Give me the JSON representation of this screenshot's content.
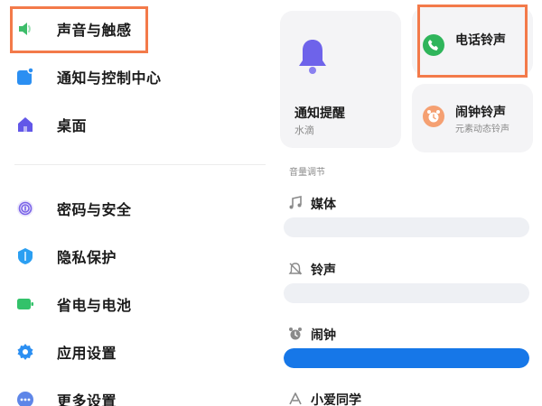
{
  "sidebar": {
    "items": [
      {
        "label": "声音与触感",
        "icon": "speaker-icon",
        "color": "#3dbd6a"
      },
      {
        "label": "通知与控制中心",
        "icon": "notification-icon",
        "color": "#2b8ff2"
      },
      {
        "label": "桌面",
        "icon": "home-icon",
        "color": "#6257e8"
      },
      {
        "label": "密码与安全",
        "icon": "fingerprint-icon",
        "color": "#7a63e8"
      },
      {
        "label": "隐私保护",
        "icon": "privacy-shield-icon",
        "color": "#2b9ff2"
      },
      {
        "label": "省电与电池",
        "icon": "battery-icon",
        "color": "#33c26a"
      },
      {
        "label": "应用设置",
        "icon": "gear-icon",
        "color": "#2b8ff2"
      },
      {
        "label": "更多设置",
        "icon": "more-icon",
        "color": "#5e86e8"
      }
    ]
  },
  "ringtones": {
    "notification": {
      "title": "通知提醒",
      "subtitle": "水滴"
    },
    "phone": {
      "title": "电话铃声"
    },
    "alarm": {
      "title": "闹钟铃声",
      "subtitle": "元素动态铃声"
    }
  },
  "volume": {
    "section_title": "音量调节",
    "rows": [
      {
        "label": "媒体",
        "icon": "music-note-icon",
        "level": 0
      },
      {
        "label": "铃声",
        "icon": "bell-muted-icon",
        "level": 0
      },
      {
        "label": "闹钟",
        "icon": "alarm-clock-icon",
        "level": 1.0
      },
      {
        "label": "小爱同学",
        "icon": "xiaoai-icon",
        "level": 0
      }
    ]
  },
  "colors": {
    "accent": "#1677e8",
    "highlight": "#f37a4a"
  }
}
